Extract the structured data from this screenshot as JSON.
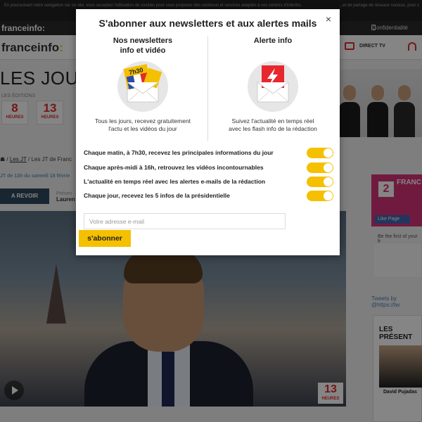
{
  "cookie_banner": {
    "text": "En poursuivant votre navigation sur ce site, vous acceptez l'utilisation de cookies pour vous proposer des contenus et services adaptés à vos centres d'intérêts.",
    "text_right": "...et de partage de réseaux sociaux, pour v"
  },
  "topbar": {
    "logo": "franceinfo:",
    "confidentialite": "Confidentialité"
  },
  "navbar": {
    "logo": "franceinfo",
    "logo_colon": ":",
    "direct_tv": "DIRECT TV"
  },
  "page": {
    "title": "LES JOURN",
    "editions_label": "LES ÉDITIONS",
    "editions": [
      {
        "number": "8",
        "label": "HEURES"
      },
      {
        "number": "13",
        "label": "HEURES"
      }
    ],
    "breadcrumb": {
      "sep": "/",
      "link": "Les JT",
      "current": "Les JT de Franc"
    },
    "date_line": "JT de 13h du samedi 18 févrie",
    "revoir": "A REVOIR",
    "presente_label": "Présen",
    "presenter_name": "Lauren",
    "video_logo": {
      "number": "13",
      "label": "HEURES"
    }
  },
  "sidebar": {
    "fb_title": "FRANC",
    "fb_number": "2",
    "like_page": "Like Page",
    "first_friends": "Be the first of your fr",
    "tweets": "Tweets by @https://tw",
    "presenters_title": "LES PRÉSENT",
    "presenter_name": "David Pujadas"
  },
  "modal": {
    "title": "S'abonner aux newsletters et aux alertes mails",
    "close": "×",
    "left": {
      "title_line1": "Nos newsletters",
      "title_line2": "info et vidéo",
      "badge": "7h30",
      "text_line1": "Tous les jours, recevez gratuitement",
      "text_line2": "l'actu et les vidéos du jour"
    },
    "right": {
      "title": "Alerte info",
      "text_line1": "Suivez l'actualité en temps réel",
      "text_line2": "avec les flash info de la rédaction"
    },
    "options": [
      {
        "label": "Chaque matin, à 7h30, recevez les principales informations du jour",
        "on": true
      },
      {
        "label": "Chaque après-midi à 16h, retrouvez les vidéos incontournables",
        "on": true
      },
      {
        "label": "L'actualité en temps réel avec les alertes e-mails de la rédaction",
        "on": true
      },
      {
        "label": "Chaque jour, recevez les 5 infos de la présidentielle",
        "on": true
      }
    ],
    "email_placeholder": "Votre adresse e-mail",
    "submit": "s'abonner"
  },
  "colors": {
    "accent": "#f5c000",
    "brand_red": "#e02c2c",
    "alert_red": "#e8262e"
  }
}
